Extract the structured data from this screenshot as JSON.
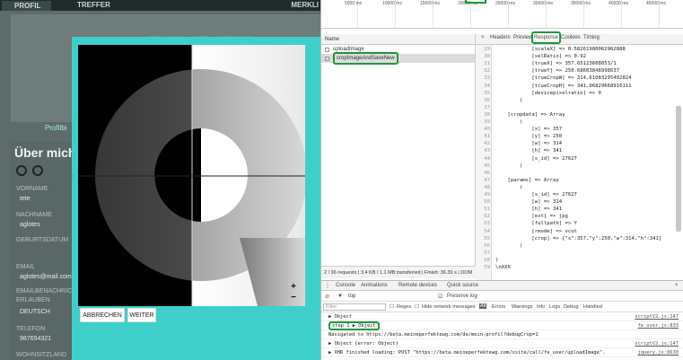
{
  "site": {
    "nav": {
      "profil": "PROFIL",
      "treffer": "TREFFER",
      "merkliste": "MERKLI"
    },
    "profilbild_label": "Profilbi",
    "banner_text": "PROFIL",
    "ueber_mich": "Über mich",
    "fields": [
      {
        "label": "VORNAME",
        "value": "tete"
      },
      {
        "label": "NACHNAME",
        "value": "aglotes"
      },
      {
        "label": "GEBURTSDATUM",
        "value": ""
      },
      {
        "label": "EMAIL",
        "value": "aglotes@mail.com"
      },
      {
        "label": "EMAILBENACHRICHTIGUNG",
        "value": ""
      },
      {
        "label": "ERLAUBEN",
        "value": "DEUTSCH"
      },
      {
        "label": "TELEFON",
        "value": "987654321"
      },
      {
        "label": "WOHNSITZLAND",
        "value": ""
      }
    ]
  },
  "modal": {
    "zoom_in": "+",
    "zoom_out": "−",
    "cancel_label": "ABBRECHEN",
    "next_label": "WEITER"
  },
  "devtools": {
    "timeline_ticks": [
      "5000 ms",
      "10000 ms",
      "15000 ms",
      "20000 ms",
      "25000 ms",
      "30000 ms",
      "35000 ms",
      "40000 ms",
      "45000 ms"
    ],
    "network": {
      "name_header": "Name",
      "requests": [
        {
          "name": "uploadImage",
          "selected": false
        },
        {
          "name": "cropImageAndSaveNew",
          "selected": true
        }
      ],
      "status": "2 / 96 requests  |  3.4 KB / 1.1 MB transferred  |  Finish: 36.39 s  |  DOM"
    },
    "tabs": {
      "close": "×",
      "headers": "Headers",
      "preview": "Preview",
      "response": "Response",
      "cookies": "Cookies",
      "timing": "Timing"
    },
    "response_lines": [
      {
        "n": "29",
        "t": "            [scaleX] => 0.58261980062962888"
      },
      {
        "n": "30",
        "t": "            [selRatio] => 0.92"
      },
      {
        "n": "31",
        "t": "            [trueX] => 357.65123608053/1"
      },
      {
        "n": "32",
        "t": "            [trueY] => 250.68603848998637"
      },
      {
        "n": "33",
        "t": "            [trueCropW] => 314.61083295402824"
      },
      {
        "n": "34",
        "t": "            [trueCropH] => 341.96829668916111"
      },
      {
        "n": "35",
        "t": "            [devicepixelratio] => 0"
      },
      {
        "n": "36",
        "t": "        )"
      },
      {
        "n": "37",
        "t": ""
      },
      {
        "n": "38",
        "t": "    [cropdata] => Array"
      },
      {
        "n": "39",
        "t": "        ("
      },
      {
        "n": "40",
        "t": "            [x] => 357"
      },
      {
        "n": "41",
        "t": "            [y] => 250"
      },
      {
        "n": "42",
        "t": "            [w] => 314"
      },
      {
        "n": "43",
        "t": "            [h] => 341"
      },
      {
        "n": "44",
        "t": "            [s_id] => 27627"
      },
      {
        "n": "45",
        "t": "        )"
      },
      {
        "n": "46",
        "t": ""
      },
      {
        "n": "47",
        "t": "    [params] => Array"
      },
      {
        "n": "48",
        "t": "        ("
      },
      {
        "n": "49",
        "t": "            [s_id] => 27627"
      },
      {
        "n": "50",
        "t": "            [w] => 314"
      },
      {
        "n": "51",
        "t": "            [h] => 341"
      },
      {
        "n": "52",
        "t": "            [ext] => jpg"
      },
      {
        "n": "53",
        "t": "            [fullpath] => Y"
      },
      {
        "n": "54",
        "t": "            [rmode] => vcut"
      },
      {
        "n": "55",
        "t": "            [crop] => {\"x\":357,\"y\":250,\"w\":314,\"h\":341}"
      },
      {
        "n": "56",
        "t": "        )"
      },
      {
        "n": "57",
        "t": ""
      },
      {
        "n": "58",
        "t": ")"
      },
      {
        "n": "59",
        "t": "\\nXXX"
      }
    ],
    "console": {
      "tabs": [
        "Console",
        "Animations",
        "Remote devices",
        "Quick source"
      ],
      "context": "top",
      "preserve_log": "Preserve log",
      "filter_placeholder": "Filter",
      "filter_options": [
        "Regex",
        "Hide network messages",
        "All",
        "Errors",
        "Warnings",
        "Info",
        "Logs",
        "Debug",
        "Handled"
      ],
      "lines": [
        {
          "text": "▶ Object",
          "src": "scriptV2.js:147",
          "type": "log"
        },
        {
          "text": "step 1 ▶ Object",
          "src": "fe_user.js:833",
          "type": "log"
        },
        {
          "text": "Navigated to https://beta.meineperfektewg.com/de/mein-profil?debugCrop=1",
          "src": "",
          "type": "nav"
        },
        {
          "text": "▶ Object {error: Object}",
          "src": "scriptV2.js:147",
          "type": "log"
        },
        {
          "text": "▶ XHR finished loading: POST \"https://beta.meineperfektewg.com/xsite/call/fe_user/uploadImage\".",
          "src": "jquery.js:8630",
          "type": "log"
        }
      ]
    }
  }
}
